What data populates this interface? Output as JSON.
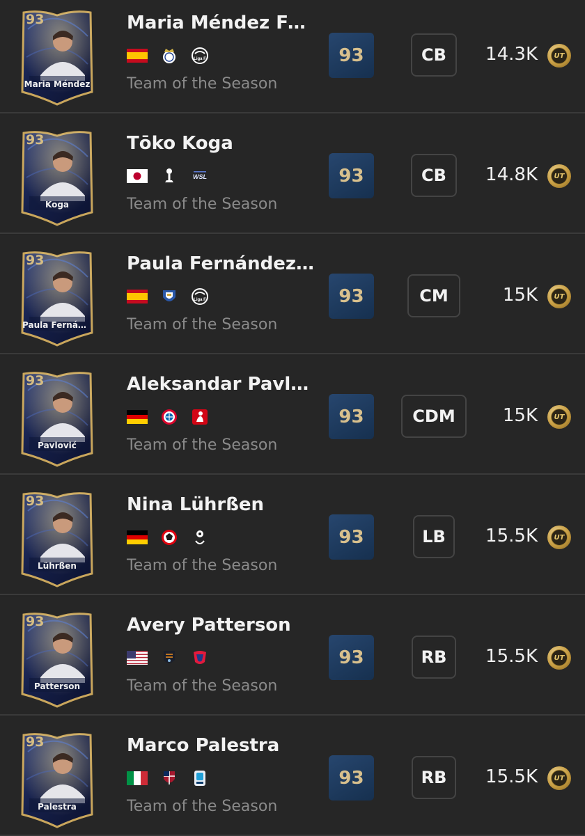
{
  "promo_label": "Team of the Season",
  "coin_label": "UT",
  "colors": {
    "background": "#262626",
    "divider": "#3a3a3a",
    "rating_bg": "#1d3b61",
    "rating_text": "#d8c08d",
    "coin_gold": "#d4ad52",
    "promo_text": "#8a8a8a"
  },
  "players": [
    {
      "card_rating": "93",
      "card_name": "Maria Méndez",
      "name": "Maria Méndez Fer...",
      "rating": "93",
      "position": "CB",
      "price": "14.3K",
      "nation_icon": "spain-flag-icon",
      "club_icon": "real-madrid-crest-icon",
      "league_icon": "liga-f-logo-icon",
      "league_text": "Liga F"
    },
    {
      "card_rating": "93",
      "card_name": "Koga",
      "name": "Tōko Koga",
      "rating": "93",
      "position": "CB",
      "price": "14.8K",
      "nation_icon": "japan-flag-icon",
      "club_icon": "tottenham-crest-icon",
      "league_icon": "wsl-logo-icon",
      "league_text": "WSL"
    },
    {
      "card_rating": "93",
      "card_name": "Paula Fernánde...",
      "name": "Paula Fernández ...",
      "rating": "93",
      "position": "CM",
      "price": "15K",
      "nation_icon": "spain-flag-icon",
      "club_icon": "real-sociedad-crest-icon",
      "league_icon": "liga-f-logo-icon",
      "league_text": "Liga F"
    },
    {
      "card_rating": "93",
      "card_name": "Pavlović",
      "name": "Aleksandar Pavlo...",
      "rating": "93",
      "position": "CDM",
      "price": "15K",
      "nation_icon": "germany-flag-icon",
      "club_icon": "bayern-crest-icon",
      "league_icon": "bundesliga-logo-icon",
      "league_text": "BUNDESLIGA"
    },
    {
      "card_rating": "93",
      "card_name": "Lührßen",
      "name": "Nina Lührßen",
      "rating": "93",
      "position": "LB",
      "price": "15.5K",
      "nation_icon": "germany-flag-icon",
      "club_icon": "eintracht-frankfurt-crest-icon",
      "league_icon": "frauen-bundesliga-logo-icon",
      "league_text": ""
    },
    {
      "card_rating": "93",
      "card_name": "Patterson",
      "name": "Avery Patterson",
      "rating": "93",
      "position": "RB",
      "price": "15.5K",
      "nation_icon": "usa-flag-icon",
      "club_icon": "houston-dash-crest-icon",
      "league_icon": "nwsl-logo-icon",
      "league_text": ""
    },
    {
      "card_rating": "93",
      "card_name": "Palestra",
      "name": "Marco Palestra",
      "rating": "93",
      "position": "RB",
      "price": "15.5K",
      "nation_icon": "italy-flag-icon",
      "club_icon": "cagliari-crest-icon",
      "league_icon": "serie-a-logo-icon",
      "league_text": ""
    }
  ]
}
